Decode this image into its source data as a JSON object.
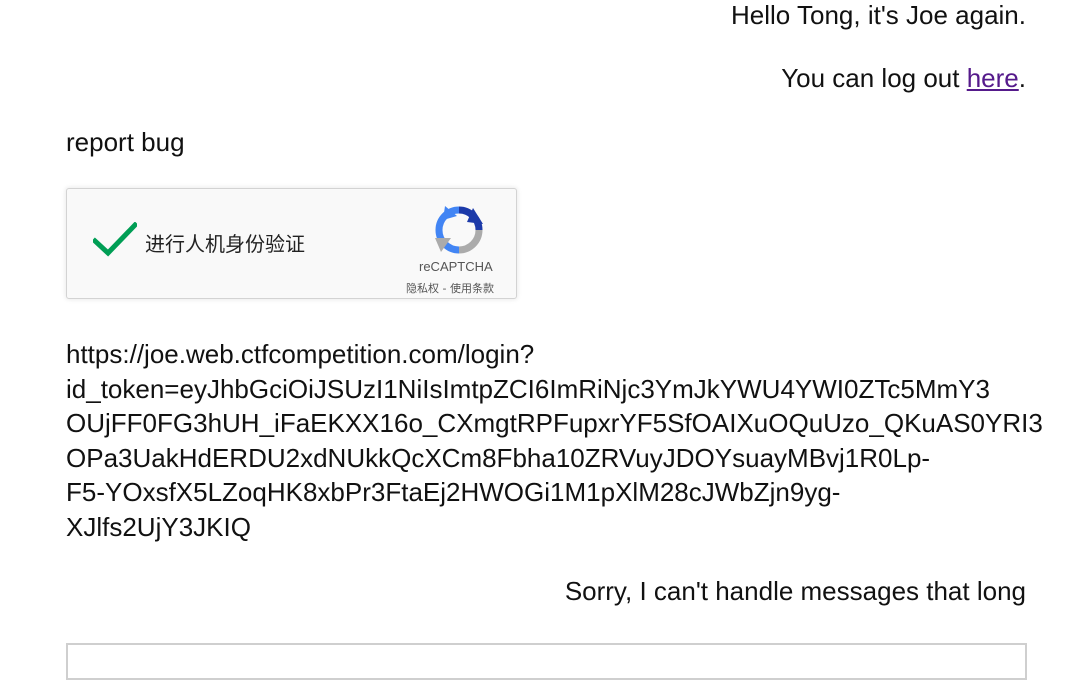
{
  "chat": {
    "greeting": "Hello Tong, it's Joe again.",
    "logout_prefix": "You can log out ",
    "logout_link": "here",
    "logout_suffix": ".",
    "user_message": "report bug",
    "url_lines": [
      "https://joe.web.ctfcompetition.com/login?",
      "id_token=eyJhbGciOiJSUzI1NiIsImtpZCI6ImRiNjc3YmJkYWU4YWI0ZTc5MmY3",
      "OUjFF0FG3hUH_iFaEKXX16o_CXmgtRPFupxrYF5SfOAIXuOQuUzo_QKuAS0YRI3",
      "OPa3UakHdERDU2xdNUkkQcXCm8Fbha10ZRVuyJDOYsuayMBvj1R0Lp-",
      "F5-YOxsfX5LZoqHK8xbPr3FtaEj2HWOGi1M1pXlM28cJWbZjn9yg-",
      "XJlfs2UjY3JKIQ"
    ],
    "bot_reply": "Sorry, I can't handle messages that long"
  },
  "recaptcha": {
    "label": "进行人机身份验证",
    "brand": "reCAPTCHA",
    "terms": "隐私权 - 使用条款",
    "checked": true,
    "colors": {
      "check": "#009e55",
      "logo_blue": "#1c3aa9",
      "logo_light_blue": "#4285f4",
      "logo_gray": "#ababab"
    }
  },
  "input": {
    "value": "",
    "placeholder": ""
  }
}
